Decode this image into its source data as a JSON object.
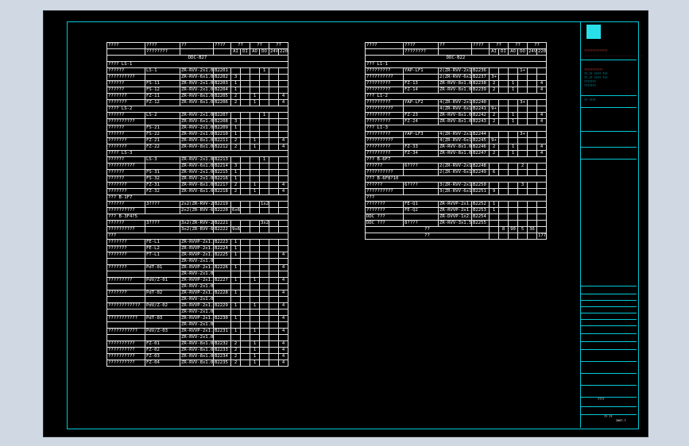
{
  "header_cols": [
    "????",
    "????",
    "??",
    "????",
    "??",
    "??",
    "??"
  ],
  "sub_cols": [
    "AI",
    "DI",
    "AO",
    "DO",
    "24V",
    "220V"
  ],
  "left": {
    "panel": "DDC-B27",
    "header_extra": "????????",
    "rows": [
      {
        "t": "sec",
        "a": "????  LS-1"
      },
      {
        "a": "??????",
        "b": "LS-1",
        "c": "ZR-RVV-2x1.0",
        "d": "B2201",
        "v": [
          "",
          "",
          "",
          "1",
          "",
          ""
        ]
      },
      {
        "a": "??????????",
        "b": "",
        "c": "ZR-RVV-6x1.0",
        "d": "B2202",
        "v": [
          "3",
          "",
          "",
          "",
          "",
          ""
        ]
      },
      {
        "a": "??????",
        "b": "FS-11",
        "c": "ZR-RVV-2x1.0",
        "d": "B2203",
        "v": [
          "1",
          "",
          "",
          "",
          "",
          ""
        ]
      },
      {
        "a": "??????",
        "b": "FS-12",
        "c": "ZR-RVV-2x1.0",
        "d": "B2204",
        "v": [
          "1",
          "",
          "",
          "",
          "",
          ""
        ]
      },
      {
        "a": "???????",
        "b": "FZ-11",
        "c": "ZR-RVV-8x1.0",
        "d": "B2205",
        "v": [
          "2",
          "",
          "1",
          "",
          "",
          "4"
        ]
      },
      {
        "a": "???????",
        "b": "FZ-12",
        "c": "ZR-RVV-8x1.0",
        "d": "B2206",
        "v": [
          "2",
          "",
          "1",
          "",
          "",
          "4"
        ]
      },
      {
        "t": "sec",
        "a": "????  LS-2"
      },
      {
        "a": "??????",
        "b": "LS-2",
        "c": "ZR-RVV-2x1.0",
        "d": "B2207",
        "v": [
          "",
          "",
          "",
          "1",
          "",
          ""
        ]
      },
      {
        "a": "??????????",
        "b": "",
        "c": "ZR-RVV-6x1.0",
        "d": "B2208",
        "v": [
          "3",
          "",
          "",
          "",
          "",
          ""
        ]
      },
      {
        "a": "??????",
        "b": "FS-21",
        "c": "ZR-RVV-2x1.0",
        "d": "B2209",
        "v": [
          "1",
          "",
          "",
          "",
          "",
          ""
        ]
      },
      {
        "a": "??????",
        "b": "FS-22",
        "c": "ZR-RVV-2x1.0",
        "d": "B2210",
        "v": [
          "1",
          "",
          "",
          "",
          "",
          ""
        ]
      },
      {
        "a": "???????",
        "b": "FZ-21",
        "c": "ZR-RVV-8x1.0",
        "d": "B2211",
        "v": [
          "2",
          "",
          "1",
          "",
          "",
          "4"
        ]
      },
      {
        "a": "???????",
        "b": "FZ-22",
        "c": "ZR-RVV-8x1.0",
        "d": "B2212",
        "v": [
          "2",
          "",
          "1",
          "",
          "",
          "4"
        ]
      },
      {
        "t": "sec",
        "a": "????  LS-3"
      },
      {
        "a": "??????",
        "b": "LS-3",
        "c": "ZR-RVV-2x1.0",
        "d": "B2213",
        "v": [
          "",
          "",
          "",
          "1",
          "",
          ""
        ]
      },
      {
        "a": "??????????",
        "b": "",
        "c": "ZR-RVV-6x1.0",
        "d": "B2214",
        "v": [
          "3",
          "",
          "",
          "",
          "",
          ""
        ]
      },
      {
        "a": "??????",
        "b": "FS-31",
        "c": "ZR-RVV-2x1.0",
        "d": "B2215",
        "v": [
          "1",
          "",
          "",
          "",
          "",
          ""
        ]
      },
      {
        "a": "??????",
        "b": "FS-32",
        "c": "ZR-RVV-2x1.0",
        "d": "B2216",
        "v": [
          "1",
          "",
          "",
          "",
          "",
          ""
        ]
      },
      {
        "a": "???????",
        "b": "FZ-31",
        "c": "ZR-RVV-8x1.0",
        "d": "B2217",
        "v": [
          "2",
          "",
          "1",
          "",
          "",
          "4"
        ]
      },
      {
        "a": "???????",
        "b": "FZ-32",
        "c": "ZR-RVV-8x1.0",
        "d": "B2218",
        "v": [
          "2",
          "",
          "1",
          "",
          "",
          "4"
        ]
      },
      {
        "t": "sec",
        "a": "???  B-1F7"
      },
      {
        "a": "??????",
        "b": "3????",
        "c": "2x2(ZR-RVV-2x1.0)",
        "d": "B2219",
        "v": [
          "",
          "",
          "",
          "1x2",
          "",
          ""
        ]
      },
      {
        "a": "??????????",
        "b": "",
        "c": "2x2(ZR-RVV-6x1.0)",
        "d": "B2220",
        "v": [
          "6x6",
          "",
          "",
          "",
          "",
          ""
        ]
      },
      {
        "t": "sec",
        "a": "???  B-3F4?5"
      },
      {
        "a": "??????",
        "b": "3????",
        "c": "3x2(ZR-RVV-2x1.0)",
        "d": "B2221",
        "v": [
          "",
          "",
          "",
          "3x2",
          "",
          ""
        ]
      },
      {
        "a": "??????????",
        "b": "",
        "c": "3x2(ZR-RVV-6x1.0)",
        "d": "B2222",
        "v": [
          "9x6",
          "",
          "",
          "",
          "",
          ""
        ]
      },
      {
        "t": "sec",
        "a": "???"
      },
      {
        "a": "???????",
        "b": "FE-L1",
        "c": "ZR-RVVP-2x1.0",
        "d": "B2223",
        "v": [
          "1",
          "",
          "",
          "",
          "",
          ""
        ]
      },
      {
        "a": "???????",
        "b": "FE-L2",
        "c": "ZR-RVVP-2x1.0",
        "d": "B2224",
        "v": [
          "1",
          "",
          "",
          "",
          "",
          ""
        ]
      },
      {
        "a": "???????",
        "b": "FT-L1",
        "c": "ZR-RVVP-2x1.0",
        "d": "B2225",
        "v": [
          "1",
          "",
          "",
          "",
          "",
          "4"
        ]
      },
      {
        "a": "",
        "b": "",
        "c": "ZR-RVV-2x1.0",
        "d": "",
        "v": [
          "",
          "",
          "",
          "",
          "",
          ""
        ]
      },
      {
        "a": "???????",
        "b": "PdT-01",
        "c": "ZR-RVVP-2x1.0",
        "d": "B2226",
        "v": [
          "1",
          "",
          "",
          "",
          "",
          "4"
        ]
      },
      {
        "a": "",
        "b": "",
        "c": "ZR-RVV-2x1.0",
        "d": "",
        "v": [
          "",
          "",
          "",
          "",
          "",
          ""
        ]
      },
      {
        "a": "?????????",
        "b": "PdV/Z-01",
        "c": "ZR-RVVP-2x1.0",
        "d": "B2227",
        "v": [
          "1",
          "",
          "1",
          "",
          "",
          "4"
        ]
      },
      {
        "a": "",
        "b": "",
        "c": "ZR-RVV-2x1.0",
        "d": "",
        "v": [
          "",
          "",
          "",
          "",
          "",
          ""
        ]
      },
      {
        "a": "???????",
        "b": "PdT-02",
        "c": "ZR-RVVP-2x1.0",
        "d": "B2228",
        "v": [
          "1",
          "",
          "",
          "",
          "",
          "4"
        ]
      },
      {
        "a": "",
        "b": "",
        "c": "ZR-RVV-2x1.0",
        "d": "",
        "v": [
          "",
          "",
          "",
          "",
          "",
          ""
        ]
      },
      {
        "a": "????????????",
        "b": "PdV/Z-02",
        "c": "ZR-RVVP-2x1.0",
        "d": "B2229",
        "v": [
          "1",
          "",
          "1",
          "",
          "",
          "4"
        ]
      },
      {
        "a": "",
        "b": "",
        "c": "ZR-RVV-2x1.0",
        "d": "",
        "v": [
          "",
          "",
          "",
          "",
          "",
          ""
        ]
      },
      {
        "a": "???????????",
        "b": "PdT-03",
        "c": "ZR-RVVP-2x1.0",
        "d": "B2230",
        "v": [
          "1",
          "",
          "",
          "",
          "",
          "4"
        ]
      },
      {
        "a": "",
        "b": "",
        "c": "ZR-RVV-2x1.0",
        "d": "",
        "v": [
          "",
          "",
          "",
          "",
          "",
          ""
        ]
      },
      {
        "a": "???????????",
        "b": "PdV/Z-03",
        "c": "ZR-RVVP-2x1.0",
        "d": "B2231",
        "v": [
          "1",
          "",
          "1",
          "",
          "",
          "4"
        ]
      },
      {
        "a": "",
        "b": "",
        "c": "ZR-RVV-2x1.0",
        "d": "",
        "v": [
          "",
          "",
          "",
          "",
          "",
          ""
        ]
      },
      {
        "a": "??????????",
        "b": "FZ-01",
        "c": "ZR-RVV-8x1.0",
        "d": "B2232",
        "v": [
          "2",
          "",
          "1",
          "",
          "",
          "4"
        ]
      },
      {
        "a": "??????????",
        "b": "FZ-02",
        "c": "ZR-RVV-8x1.0",
        "d": "B2233",
        "v": [
          "2",
          "",
          "1",
          "",
          "",
          "4"
        ]
      },
      {
        "a": "??????????",
        "b": "FZ-03",
        "c": "ZR-RVV-8x1.0",
        "d": "B2234",
        "v": [
          "2",
          "",
          "1",
          "",
          "",
          "4"
        ]
      },
      {
        "a": "??????????",
        "b": "FZ-04",
        "c": "ZR-RVV-8x1.0",
        "d": "B2235",
        "v": [
          "2",
          "",
          "1",
          "",
          "",
          "4"
        ]
      }
    ]
  },
  "right": {
    "panel": "DDC-B22",
    "header_extra": "????????",
    "rows": [
      {
        "t": "sec",
        "a": "???  L1-1"
      },
      {
        "a": "?????????",
        "b": "YAP-LF1",
        "c": "2(ZR-RVV-2x1.0)",
        "d": "B2236",
        "v": [
          "",
          "",
          "",
          "1+",
          "",
          ""
        ]
      },
      {
        "a": "??????????",
        "b": "",
        "c": "2(ZR-RVV-6x1.0)",
        "d": "B2237",
        "v": [
          "3+",
          "",
          "",
          "",
          "",
          ""
        ]
      },
      {
        "a": "?????????",
        "b": "FZ-13",
        "c": "ZR-RVV-8x1.0",
        "d": "B2238",
        "v": [
          "2",
          "",
          "1",
          "",
          "",
          "4"
        ]
      },
      {
        "a": "?????????",
        "b": "FZ-14",
        "c": "ZR-RVV-8x1.0",
        "d": "B2239",
        "v": [
          "2",
          "",
          "1",
          "",
          "",
          "4"
        ]
      },
      {
        "t": "sec",
        "a": "???  L1-2"
      },
      {
        "a": "?????????",
        "b": "YAP-LF2",
        "c": "4(ZR-RVV-2x1.0)",
        "d": "B2240",
        "v": [
          "",
          "",
          "",
          "3+",
          "",
          ""
        ]
      },
      {
        "a": "??????????",
        "b": "",
        "c": "4(ZR-RVV-6x1.0)",
        "d": "B2241",
        "v": [
          "9+",
          "",
          "",
          "",
          "",
          ""
        ]
      },
      {
        "a": "?????????",
        "b": "FZ-23",
        "c": "ZR-RVV-8x1.0",
        "d": "B2242",
        "v": [
          "2",
          "",
          "1",
          "",
          "",
          "4"
        ]
      },
      {
        "a": "?????????",
        "b": "FZ-24",
        "c": "ZR-RVV-8x1.0",
        "d": "B2243",
        "v": [
          "2",
          "",
          "1",
          "",
          "",
          "4"
        ]
      },
      {
        "t": "sec",
        "a": "???  L1-3"
      },
      {
        "a": "?????????",
        "b": "YAP-LF3",
        "c": "4(ZR-RVV-2x1.0)",
        "d": "B2244",
        "v": [
          "",
          "",
          "",
          "3+",
          "",
          ""
        ]
      },
      {
        "a": "??????????",
        "b": "",
        "c": "4(ZR-RVV-6x1.0)",
        "d": "B2245",
        "v": [
          "9+",
          "",
          "",
          "",
          "",
          ""
        ]
      },
      {
        "a": "?????????",
        "b": "FZ-33",
        "c": "ZR-RVV-8x1.0",
        "d": "B2246",
        "v": [
          "2",
          "",
          "1",
          "",
          "",
          "4"
        ]
      },
      {
        "a": "?????????",
        "b": "FZ-34",
        "c": "ZR-RVV-8x1.0",
        "d": "B2247",
        "v": [
          "2",
          "",
          "1",
          "",
          "",
          "4"
        ]
      },
      {
        "t": "sec",
        "a": "???  B-6F7"
      },
      {
        "a": "??????",
        "b": "6????",
        "c": "2(ZR-RVV-2x1.0)",
        "d": "B2248",
        "v": [
          "",
          "",
          "",
          "2",
          "",
          ""
        ]
      },
      {
        "a": "??????????",
        "b": "",
        "c": "2(ZR-RVV-6x1.0)",
        "d": "B2249",
        "v": [
          "6",
          "",
          "",
          "",
          "",
          ""
        ]
      },
      {
        "t": "sec",
        "a": "???  B-6F8?10"
      },
      {
        "a": "??????",
        "b": "6????",
        "c": "3(ZR-RVV-2x1.0)",
        "d": "B2250",
        "v": [
          "",
          "",
          "",
          "3",
          "",
          ""
        ]
      },
      {
        "a": "??????????",
        "b": "",
        "c": "3(ZR-RVV-6x1.0)",
        "d": "B2251",
        "v": [
          "9",
          "",
          "",
          "",
          "",
          ""
        ]
      },
      {
        "t": "sec",
        "a": "???"
      },
      {
        "a": "???????",
        "b": "FE-Q1",
        "c": "ZR-RVVP-2x1.0",
        "d": "B2252",
        "v": [
          "1",
          "",
          "",
          "",
          "",
          ""
        ]
      },
      {
        "a": "???????",
        "b": "FE-Q2",
        "c": "ZR-RVVP-2x1.0",
        "d": "B2253",
        "v": [
          "1",
          "",
          "",
          "",
          "",
          ""
        ]
      },
      {
        "a": "DDC ???",
        "b": "",
        "c": "ZR-DVVP-1x2.0",
        "d": "B2254",
        "v": [
          "",
          "",
          "",
          "",
          "",
          ""
        ]
      },
      {
        "a": "DDC ???",
        "b": "8????",
        "c": "ZR-RVV-3x1.5",
        "d": "B2255",
        "v": [
          "",
          "",
          "",
          "",
          "",
          ""
        ]
      },
      {
        "t": "tot",
        "a": "??",
        "v": [
          "",
          "8",
          "90",
          "5",
          "36",
          ""
        ]
      },
      {
        "t": "tot",
        "a": "??",
        "v": [
          "",
          "",
          "",
          "",
          "",
          "177"
        ]
      }
    ]
  },
  "titleblock": {
    "company": "??????????????",
    "company_en": "...................................",
    "lines": [
      "???????????",
      "??-??  ???? ???",
      "??-??  ???? ???",
      "???????",
      "???????",
      "?? ????"
    ],
    "drawing_no": "????",
    "sheet": "?? ??",
    "date": "2007.?"
  }
}
